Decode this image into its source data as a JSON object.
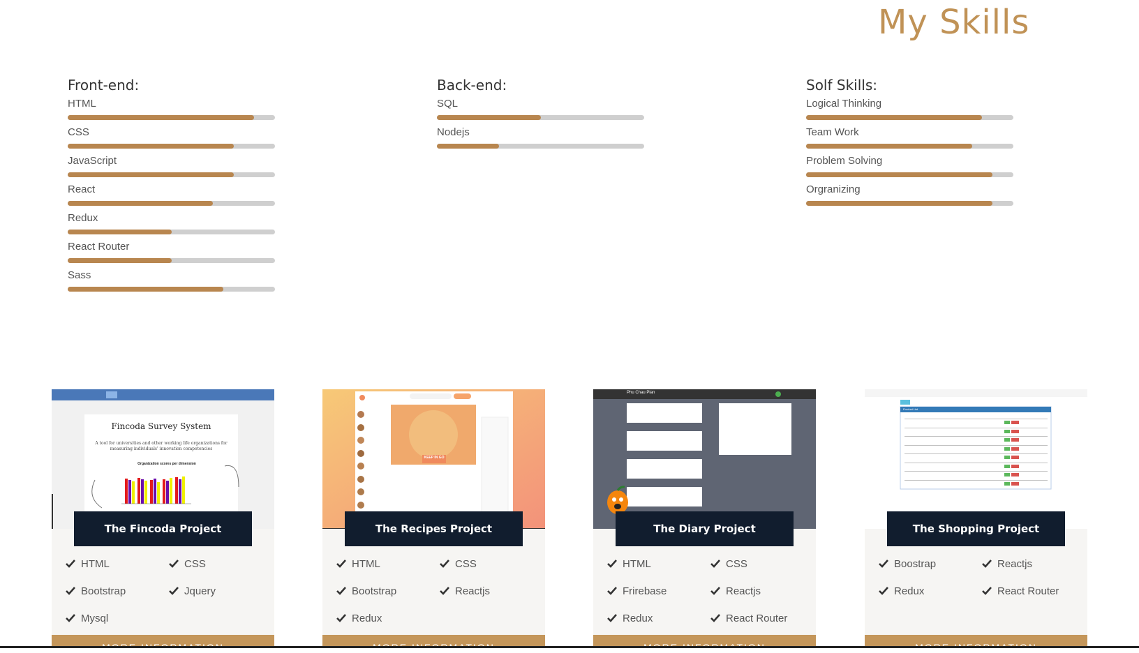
{
  "page_title": "My Skills",
  "skills": {
    "frontend": {
      "heading": "Front-end:",
      "items": [
        {
          "name": "HTML",
          "level": 0.9
        },
        {
          "name": "CSS",
          "level": 0.8
        },
        {
          "name": "JavaScript",
          "level": 0.8
        },
        {
          "name": "React",
          "level": 0.7
        },
        {
          "name": "Redux",
          "level": 0.5
        },
        {
          "name": "React Router",
          "level": 0.5
        },
        {
          "name": "Sass",
          "level": 0.75
        }
      ]
    },
    "backend": {
      "heading": "Back-end:",
      "items": [
        {
          "name": "SQL",
          "level": 0.5
        },
        {
          "name": "Nodejs",
          "level": 0.3
        }
      ]
    },
    "soft": {
      "heading": "Solf Skills:",
      "items": [
        {
          "name": "Logical Thinking",
          "level": 0.85
        },
        {
          "name": "Team Work",
          "level": 0.8
        },
        {
          "name": "Problem Solving",
          "level": 0.9
        },
        {
          "name": "Orgranizing",
          "level": 0.9
        }
      ]
    }
  },
  "projects": [
    {
      "title": "The Fincoda Project",
      "preview_title": "Fincoda Survey System",
      "preview_subtitle": "A tool for universities and other working life organizations for measuring individuals' innovation competencies",
      "preview_chart_title": "Organization scores per dimension",
      "tags": [
        "HTML",
        "CSS",
        "Bootstrap",
        "Jquery",
        "Mysql"
      ]
    },
    {
      "title": "The Recipes Project",
      "preview_badge": "KEEP IN GO",
      "tags": [
        "HTML",
        "CSS",
        "Bootstrap",
        "Reactjs",
        "Redux"
      ]
    },
    {
      "title": "The Diary Project",
      "preview_header": "Phu Chau Plan",
      "tags": [
        "HTML",
        "CSS",
        "Frirebase",
        "Reactjs",
        "Redux",
        "React Router"
      ]
    },
    {
      "title": "The Shopping Project",
      "preview_table_title": "Product List",
      "tags": [
        "Boostrap",
        "Reactjs",
        "Redux",
        "React Router"
      ]
    }
  ],
  "more_label": "MORE INFORMATION",
  "colors": {
    "accent": "#c09256",
    "bar_fill": "#b8864f",
    "bar_track": "#cfcfcf",
    "label_bg": "#111d2e",
    "card_bg": "#f6f5f3"
  }
}
